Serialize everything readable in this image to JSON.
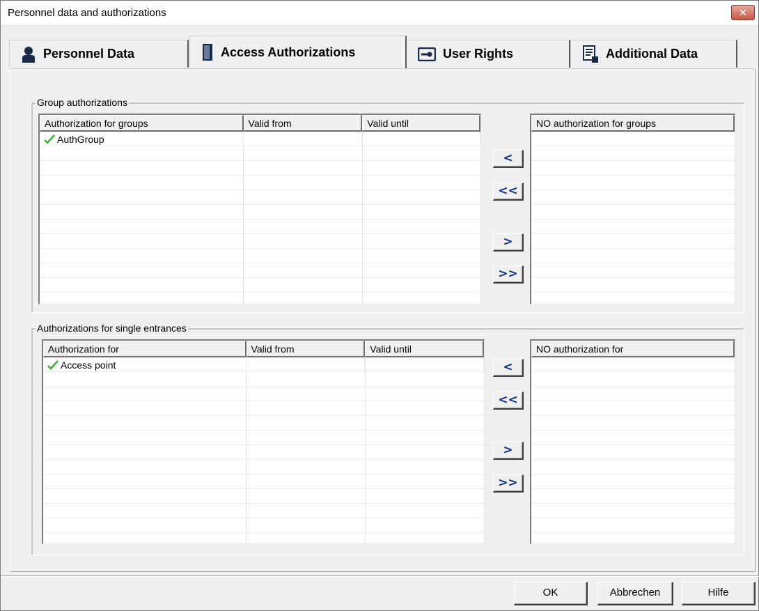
{
  "window": {
    "title": "Personnel data and authorizations",
    "close_label": "✕"
  },
  "tabs": [
    {
      "label": "Personnel Data",
      "icon": "person-icon"
    },
    {
      "label": "Access Authorizations",
      "icon": "door-icon",
      "active": true
    },
    {
      "label": "User Rights",
      "icon": "key-card-icon"
    },
    {
      "label": "Additional Data",
      "icon": "document-icon"
    }
  ],
  "group_section": {
    "label": "Group authorizations",
    "left_columns": [
      "Authorization for groups",
      "Valid from",
      "Valid until"
    ],
    "left_rows": [
      {
        "name": "AuthGroup",
        "valid_from": "",
        "valid_until": ""
      }
    ],
    "right_column": "NO authorization for groups",
    "buttons": {
      "add_one": "<",
      "add_all": "<<",
      "remove_one": ">",
      "remove_all": ">>"
    }
  },
  "single_section": {
    "label": "Authorizations for single entrances",
    "left_columns": [
      "Authorization for",
      "Valid from",
      "Valid until"
    ],
    "left_rows": [
      {
        "name": "Access point",
        "valid_from": "",
        "valid_until": ""
      }
    ],
    "right_column": "NO authorization for",
    "buttons": {
      "add_one": "<",
      "add_all": "<<",
      "remove_one": ">",
      "remove_all": ">>"
    }
  },
  "footer": {
    "ok": "OK",
    "cancel": "Abbrechen",
    "help": "Hilfe"
  },
  "colors": {
    "check": "#2fb52f",
    "arrow": "#0a2d8a",
    "close": "#c75843"
  }
}
